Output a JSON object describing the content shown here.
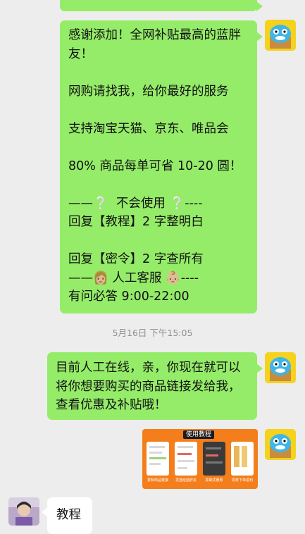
{
  "messages": {
    "welcome": {
      "lines": [
        "感谢添加！全网补贴最高的蓝胖",
        "友！",
        "",
        "网购请找我，给你最好的服务",
        "",
        "支持淘宝天猫、京东、唯品会",
        "",
        "80% 商品每单可省 10-20 圆！",
        "",
        "——❔  不会使用 ❔----",
        "回复【教程】2 字整明白",
        "",
        "回复【密令】2 字查所有",
        "——👩🏼 人工客服 👶🏼----",
        "有问必答 9:00-22:00"
      ]
    },
    "timestamp": "5月16日 下午15:05",
    "reply": {
      "lines": [
        "目前人工在线，亲，你现在就可以",
        "将你想要购买的商品链接发给我，",
        "查看优惠及补贴哦！"
      ]
    },
    "tutorial_image": {
      "title": "使用教程",
      "captions": [
        "复制商品链接",
        "发送给蓝胖友",
        "获取优惠券",
        "领券下单返利"
      ]
    },
    "user_message": {
      "text": "教程"
    }
  },
  "colors": {
    "my_bubble": "#95ec69",
    "other_bubble": "#ffffff",
    "chat_background": "#ededed",
    "tutorial_background": "#f47e1c"
  },
  "icons": {
    "bot_avatar": "blue-cartoon-cat-avatar",
    "user_avatar": "user-photo-avatar"
  }
}
